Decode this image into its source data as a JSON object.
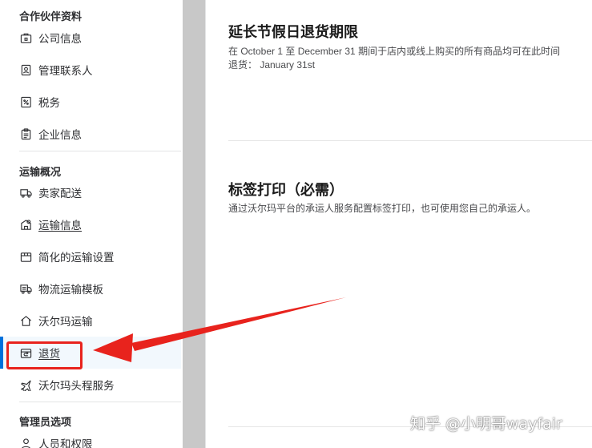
{
  "sidebar": {
    "sections": [
      {
        "header": "合作伙伴资料",
        "items": [
          {
            "label": "公司信息",
            "icon": "company-icon"
          },
          {
            "label": "管理联系人",
            "icon": "contact-card-icon"
          },
          {
            "label": "税务",
            "icon": "tax-icon"
          },
          {
            "label": "企业信息",
            "icon": "clipboard-icon"
          }
        ]
      },
      {
        "header": "运输概况",
        "items": [
          {
            "label": "卖家配送",
            "icon": "truck-icon"
          },
          {
            "label": "运输信息",
            "icon": "shipping-settings-icon"
          },
          {
            "label": "简化的运输设置",
            "icon": "box-icon"
          },
          {
            "label": "物流运输模板",
            "icon": "template-truck-icon"
          },
          {
            "label": "沃尔玛运输",
            "icon": "home-icon"
          },
          {
            "label": "退货",
            "icon": "return-icon",
            "active": true
          },
          {
            "label": "沃尔玛头程服务",
            "icon": "airplane-icon"
          }
        ]
      },
      {
        "header": "管理员选项",
        "items": [
          {
            "label": "人员和权限",
            "icon": "person-icon"
          }
        ]
      }
    ]
  },
  "main": {
    "holiday_returns": {
      "title": "延长节假日退货期限",
      "line1": "在 October 1 至 December 31 期间于店内或线上购买的所有商品均可在此时间",
      "line2": "退货： January 31st"
    },
    "label_printing": {
      "title": "标签打印（必需）",
      "description": "通过沃尔玛平台的承运人服务配置标签打印，也可使用您自己的承运人。"
    }
  },
  "watermark": "知乎 @小明哥wayfair",
  "colors": {
    "accent": "#0071dc",
    "annotation_red": "#e8231d",
    "active_bg": "#f2f8fd",
    "gutter": "#c8c8c8"
  }
}
